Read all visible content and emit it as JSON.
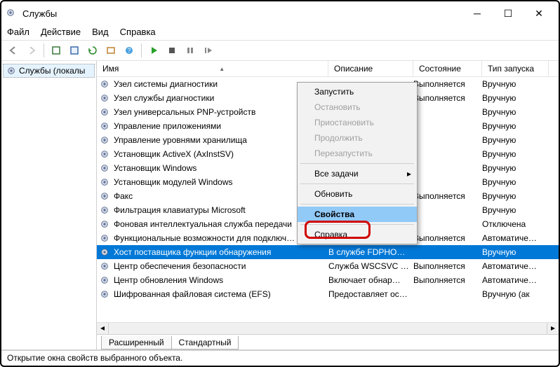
{
  "window": {
    "title": "Службы"
  },
  "menu": {
    "file": "Файл",
    "action": "Действие",
    "view": "Вид",
    "help": "Справка"
  },
  "sidebar": {
    "item": "Службы (локалы"
  },
  "columns": {
    "name": "Имя",
    "desc": "Описание",
    "state": "Состояние",
    "start": "Тип запуска"
  },
  "services": [
    {
      "name": "Узел системы диагностики",
      "desc": "",
      "state": "Выполняется",
      "start": "Вручную"
    },
    {
      "name": "Узел службы диагностики",
      "desc": "",
      "state": "Выполняется",
      "start": "Вручную"
    },
    {
      "name": "Узел универсальных PNP-устройств",
      "desc": "",
      "state": "",
      "start": "Вручную"
    },
    {
      "name": "Управление приложениями",
      "desc": "",
      "state": "",
      "start": "Вручную"
    },
    {
      "name": "Управление уровнями хранилища",
      "desc": "",
      "state": "",
      "start": "Вручную"
    },
    {
      "name": "Установщик ActiveX (AxInstSV)",
      "desc": "",
      "state": "",
      "start": "Вручную"
    },
    {
      "name": "Установщик Windows",
      "desc": "",
      "state": "",
      "start": "Вручную"
    },
    {
      "name": "Установщик модулей Windows",
      "desc": "",
      "state": "",
      "start": "Вручную"
    },
    {
      "name": "Факс",
      "desc": "",
      "state": "Выполняется",
      "start": "Вручную"
    },
    {
      "name": "Фильтрация клавиатуры Microsoft",
      "desc": "",
      "state": "",
      "start": "Вручную"
    },
    {
      "name": "Фоновая интеллектуальная служба передачи",
      "desc": "",
      "state": "",
      "start": "Отключена"
    },
    {
      "name": "Функциональные возможности для подключ…",
      "desc": "",
      "state": "Выполняется",
      "start": "Автоматиче…"
    },
    {
      "name": "Хост поставщика функции обнаружения",
      "desc": "В службе FDPHO…",
      "state": "",
      "start": "Вручную"
    },
    {
      "name": "Центр обеспечения безопасности",
      "desc": "Служба WSCSVC …",
      "state": "Выполняется",
      "start": "Автоматиче…"
    },
    {
      "name": "Центр обновления Windows",
      "desc": "Включает обнар…",
      "state": "Выполняется",
      "start": "Автоматиче…"
    },
    {
      "name": "Шифрованная файловая система (EFS)",
      "desc": "Предоставляет ос…",
      "state": "",
      "start": "Вручную (ак"
    }
  ],
  "selected_index": 12,
  "tabs": {
    "extended": "Расширенный",
    "standard": "Стандартный"
  },
  "status": "Открытие окна свойств выбранного объекта.",
  "ctx": {
    "start": "Запустить",
    "stop": "Остановить",
    "pause": "Приостановить",
    "resume": "Продолжить",
    "restart": "Перезапустить",
    "all_tasks": "Все задачи",
    "refresh": "Обновить",
    "properties": "Свойства",
    "help": "Справка"
  }
}
